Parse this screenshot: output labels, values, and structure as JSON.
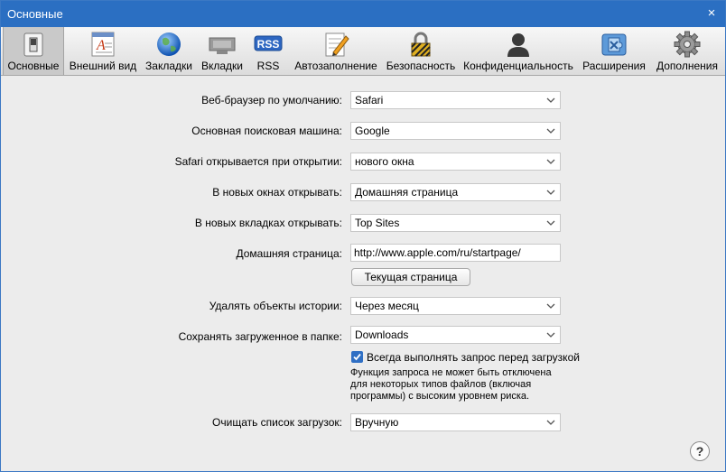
{
  "window": {
    "title": "Основные",
    "close_icon": "×"
  },
  "toolbar": {
    "items": [
      {
        "label": "Основные",
        "icon": "switch-icon"
      },
      {
        "label": "Внешний вид",
        "icon": "font-icon"
      },
      {
        "label": "Закладки",
        "icon": "globe-icon"
      },
      {
        "label": "Вкладки",
        "icon": "tabs-icon"
      },
      {
        "label": "RSS",
        "icon": "rss-icon",
        "badge": "RSS"
      },
      {
        "label": "Автозаполнение",
        "icon": "pencil-icon"
      },
      {
        "label": "Безопасность",
        "icon": "lock-icon"
      },
      {
        "label": "Конфиденциальность",
        "icon": "person-icon"
      },
      {
        "label": "Расширения",
        "icon": "puzzle-icon"
      },
      {
        "label": "Дополнения",
        "icon": "gear-icon"
      }
    ]
  },
  "form": {
    "default_browser": {
      "label": "Веб-браузер по умолчанию:",
      "value": "Safari"
    },
    "search_engine": {
      "label": "Основная поисковая машина:",
      "value": "Google"
    },
    "safari_opens": {
      "label": "Safari открывается при открытии:",
      "value": "нового окна"
    },
    "new_windows": {
      "label": "В новых окнах открывать:",
      "value": "Домашняя страница"
    },
    "new_tabs": {
      "label": "В новых вкладках открывать:",
      "value": "Top Sites"
    },
    "homepage": {
      "label": "Домашняя страница:",
      "value": "http://www.apple.com/ru/startpage/"
    },
    "current_page_button": "Текущая страница",
    "remove_history": {
      "label": "Удалять объекты истории:",
      "value": "Через месяц"
    },
    "save_downloads": {
      "label": "Сохранять загруженное в папке:",
      "value": "Downloads"
    },
    "always_ask": {
      "label": "Всегда выполнять запрос перед загрузкой",
      "checked": true
    },
    "note_lines": [
      "Функция запроса не может быть отключена",
      "для некоторых типов файлов (включая",
      "программы) с высоким уровнем риска."
    ],
    "clear_downloads": {
      "label": "Очищать список загрузок:",
      "value": "Вручную"
    },
    "help": "?"
  },
  "colors": {
    "titlebar": "#2b6fc2",
    "checkbox": "#2f6fc4",
    "background": "#ececec"
  }
}
